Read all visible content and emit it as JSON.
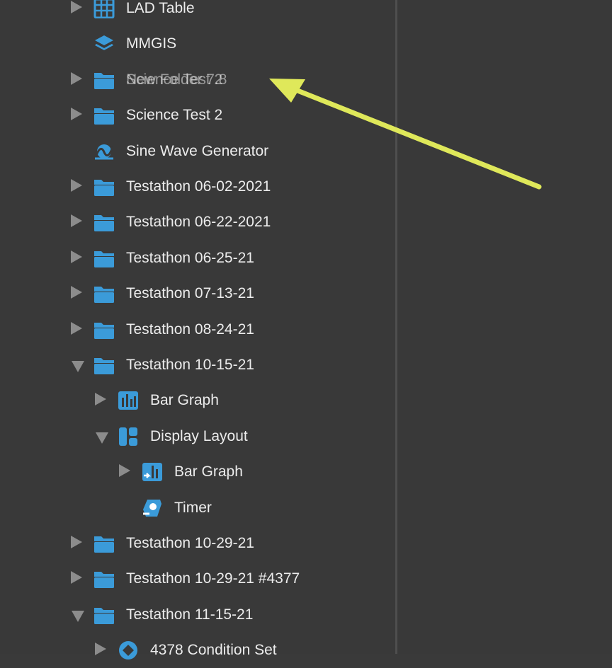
{
  "tree": [
    {
      "label": "LAD Table",
      "icon": "lad-table-icon",
      "toggle": "collapsed",
      "depth": 0
    },
    {
      "label": "MMGIS",
      "icon": "layers-icon",
      "toggle": "none",
      "depth": 0
    },
    {
      "label": "Science Test 2",
      "overlap_label": "New Folder 7.8",
      "icon": "folder-icon",
      "toggle": "collapsed",
      "depth": 0
    },
    {
      "label": "Science Test 2",
      "icon": "folder-icon",
      "toggle": "collapsed",
      "depth": 0
    },
    {
      "label": "Sine Wave Generator",
      "icon": "sine-wave-icon",
      "toggle": "none",
      "depth": 0
    },
    {
      "label": "Testathon 06-02-2021",
      "icon": "folder-icon",
      "toggle": "collapsed",
      "depth": 0
    },
    {
      "label": "Testathon 06-22-2021",
      "icon": "folder-icon",
      "toggle": "collapsed",
      "depth": 0
    },
    {
      "label": "Testathon 06-25-21",
      "icon": "folder-icon",
      "toggle": "collapsed",
      "depth": 0
    },
    {
      "label": "Testathon 07-13-21",
      "icon": "folder-icon",
      "toggle": "collapsed",
      "depth": 0
    },
    {
      "label": "Testathon 08-24-21",
      "icon": "folder-icon",
      "toggle": "collapsed",
      "depth": 0
    },
    {
      "label": "Testathon 10-15-21",
      "icon": "folder-icon",
      "toggle": "expanded",
      "depth": 0
    },
    {
      "label": "Bar Graph",
      "icon": "bar-graph-icon",
      "toggle": "collapsed",
      "depth": 1
    },
    {
      "label": "Display Layout",
      "icon": "display-layout-icon",
      "toggle": "expanded",
      "depth": 1
    },
    {
      "label": "Bar Graph",
      "icon": "bar-graph-link-icon",
      "toggle": "collapsed",
      "depth": 2
    },
    {
      "label": "Timer",
      "icon": "timer-icon",
      "toggle": "none",
      "depth": 2
    },
    {
      "label": "Testathon 10-29-21",
      "icon": "folder-icon",
      "toggle": "collapsed",
      "depth": 0
    },
    {
      "label": "Testathon 10-29-21 #4377",
      "icon": "folder-icon",
      "toggle": "collapsed",
      "depth": 0
    },
    {
      "label": "Testathon 11-15-21",
      "icon": "folder-icon",
      "toggle": "expanded",
      "depth": 0
    },
    {
      "label": "4378 Condition Set",
      "icon": "condition-set-icon",
      "toggle": "collapsed",
      "depth": 1
    }
  ],
  "colors": {
    "background": "#393939",
    "text": "#ececec",
    "icon": "#3b9bd9",
    "toggle": "#8c8c8c",
    "annotation_arrow": "#dfe85a"
  }
}
